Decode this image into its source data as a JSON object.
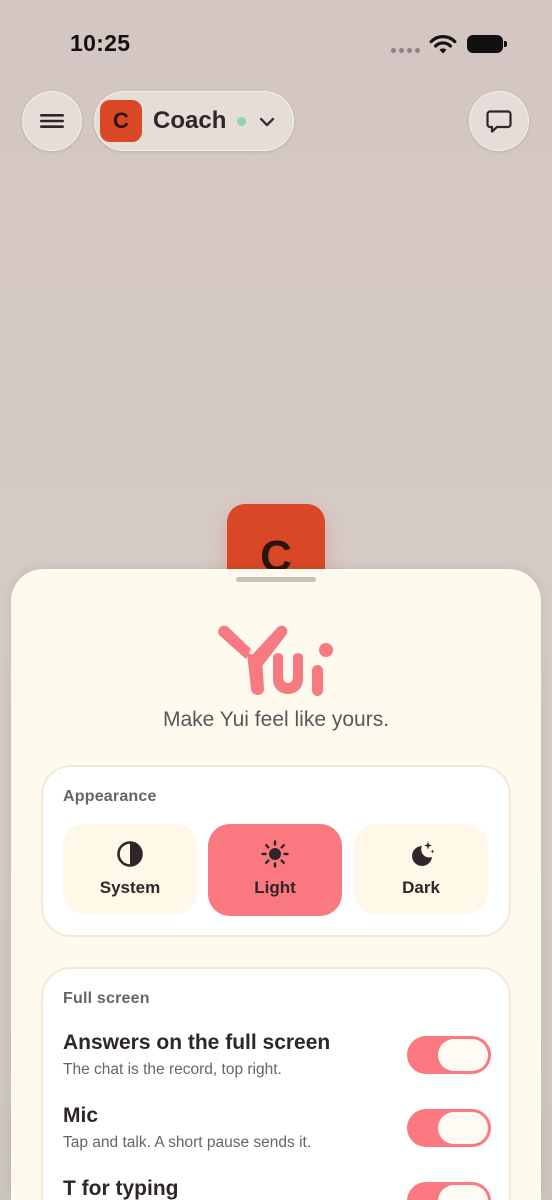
{
  "status_bar": {
    "time": "10:25"
  },
  "header": {
    "coach": {
      "avatar_letter": "C",
      "name": "Coach",
      "online_color": "#8fd3b2"
    },
    "icons": {
      "menu": "hamburger-menu-icon",
      "chat": "chat-bubble-icon",
      "dropdown": "chevron-down-icon"
    }
  },
  "floating_avatar": {
    "letter": "C"
  },
  "sheet": {
    "tagline": "Make Yui feel like yours.",
    "appearance": {
      "title": "Appearance",
      "options": [
        {
          "label": "System",
          "icon": "contrast-icon",
          "selected": false
        },
        {
          "label": "Light",
          "icon": "sun-icon",
          "selected": true
        },
        {
          "label": "Dark",
          "icon": "moon-stars-icon",
          "selected": false
        }
      ]
    },
    "full_screen": {
      "title": "Full screen",
      "settings": [
        {
          "title": "Answers on the full screen",
          "desc": "The chat is the record, top right.",
          "on": true
        },
        {
          "title": "Mic",
          "desc": "Tap and talk. A short pause sends it.",
          "on": true
        },
        {
          "title": "T for typing",
          "desc": "",
          "on": true
        }
      ]
    }
  },
  "colors": {
    "accent": "#fa7880",
    "coach": "#d94726",
    "sheet_bg": "#fffaee"
  }
}
